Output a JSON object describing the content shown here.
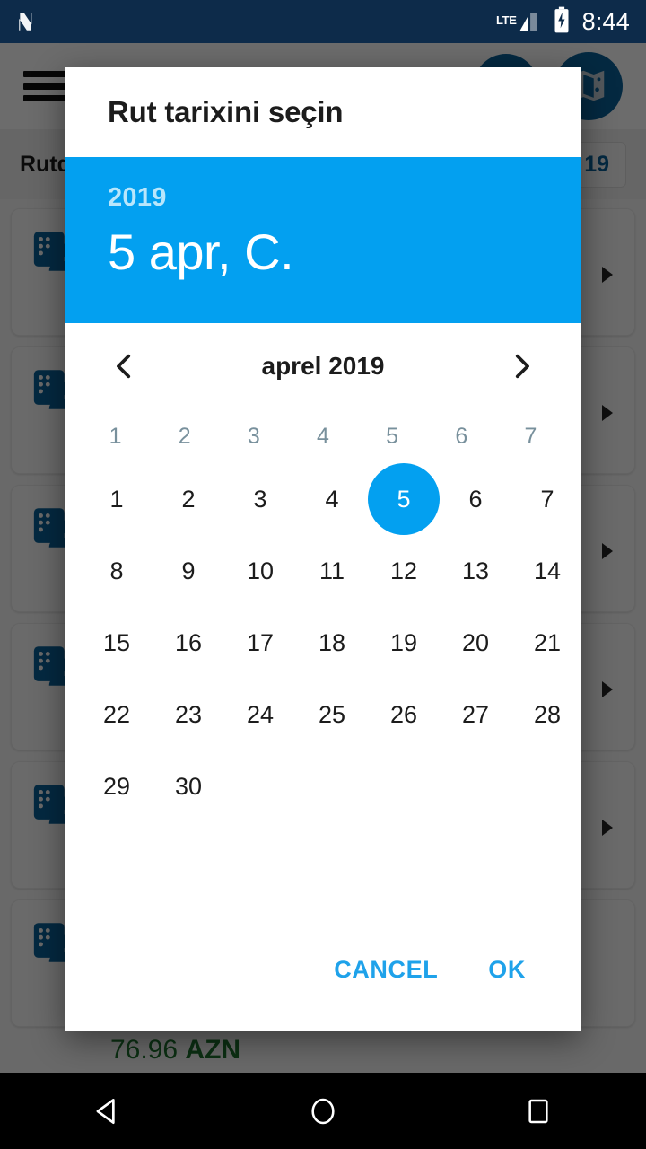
{
  "status_bar": {
    "logo_icon": "n-logo-icon",
    "network_label": "LTE",
    "signal_icon": "signal-bars-icon",
    "battery_icon": "battery-charging-icon",
    "clock": "8:44",
    "background_color": "#0d2b4a"
  },
  "background_app": {
    "menu_icon": "hamburger-menu-icon",
    "account_icon": "account-circle-icon",
    "map_icon": "map-icon",
    "filter_label": "Rutda",
    "date_chip": "19",
    "price_value": "76.96",
    "price_currency": "AZN",
    "trip_icon": "bus-seat-icon",
    "cards": [
      {
        "id": "trip-card-1"
      },
      {
        "id": "trip-card-2"
      },
      {
        "id": "trip-card-3"
      },
      {
        "id": "trip-card-4"
      },
      {
        "id": "trip-card-5"
      },
      {
        "id": "trip-card-6"
      }
    ]
  },
  "dialog": {
    "title": "Rut tarixini seçin",
    "accent_color": "#03a0f0",
    "header": {
      "year": "2019",
      "date": "5 apr, C."
    },
    "month_nav": {
      "prev_icon": "chevron-left-icon",
      "next_icon": "chevron-right-icon",
      "month_label": "aprel 2019"
    },
    "weekday_headers": [
      "1",
      "2",
      "3",
      "4",
      "5",
      "6",
      "7"
    ],
    "selected_day": 5,
    "weeks": [
      [
        "1",
        "2",
        "3",
        "4",
        "5",
        "6",
        "7"
      ],
      [
        "8",
        "9",
        "10",
        "11",
        "12",
        "13",
        "14"
      ],
      [
        "15",
        "16",
        "17",
        "18",
        "19",
        "20",
        "21"
      ],
      [
        "22",
        "23",
        "24",
        "25",
        "26",
        "27",
        "28"
      ],
      [
        "29",
        "30",
        "",
        "",
        "",
        "",
        ""
      ]
    ],
    "actions": {
      "cancel_label": "CANCEL",
      "ok_label": "OK"
    }
  },
  "nav_bar": {
    "back_icon": "back-triangle-icon",
    "home_icon": "home-circle-icon",
    "recents_icon": "recents-square-icon"
  }
}
